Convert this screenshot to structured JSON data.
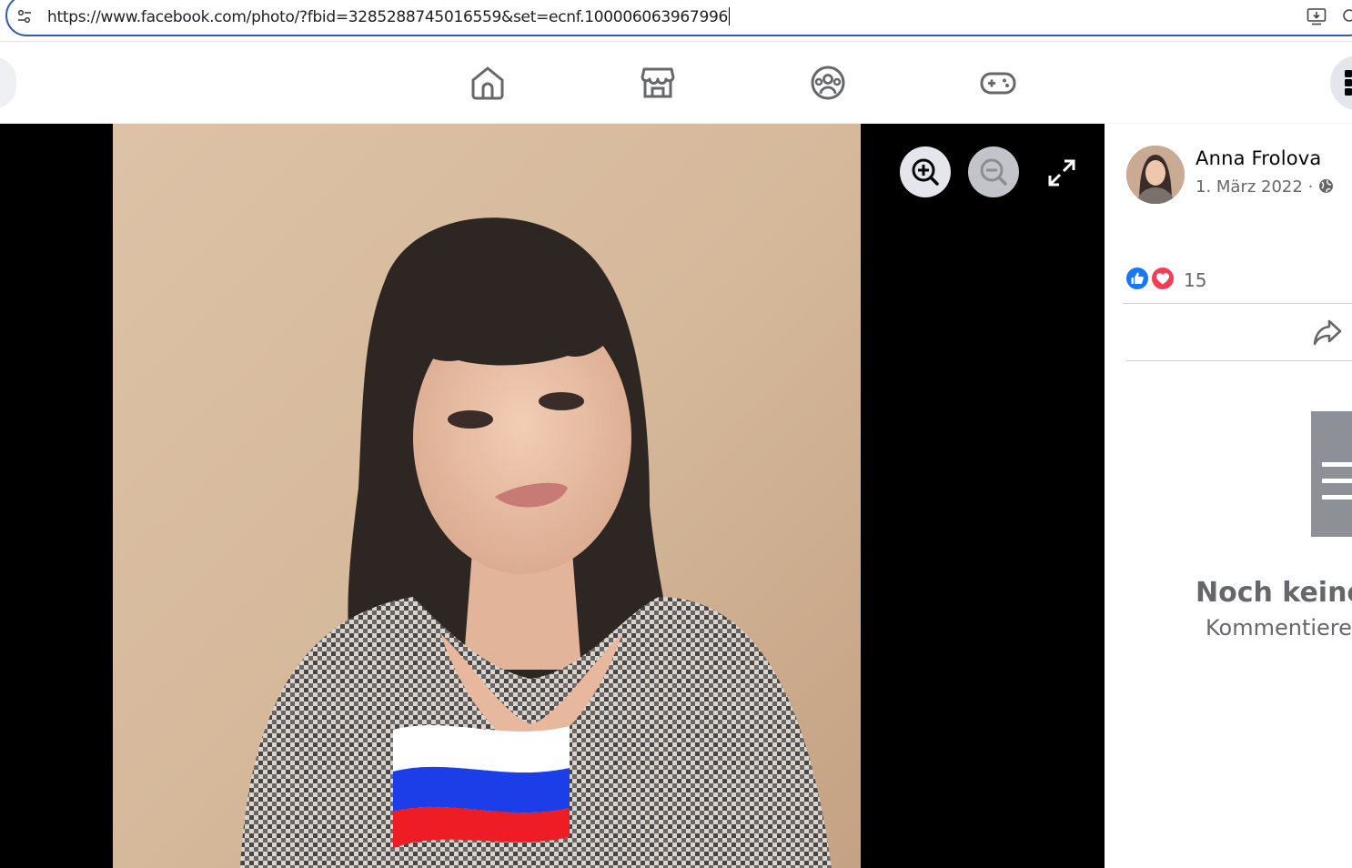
{
  "browser": {
    "url": "https://www.facebook.com/photo/?fbid=3285288745016559&set=ecnf.100006063967996",
    "icons": [
      "site-info-icon",
      "install-app-icon",
      "zoom-icon"
    ]
  },
  "nav": {
    "icons": [
      "home-icon",
      "marketplace-icon",
      "groups-icon",
      "gaming-icon",
      "menu-icon"
    ]
  },
  "viewer": {
    "photo_description_icon": "flag-russia",
    "controls": [
      "zoom-in-icon",
      "zoom-out-icon",
      "fullscreen-icon"
    ]
  },
  "post": {
    "author": "Anna Frolova",
    "date": "1. März 2022",
    "date_separator": "·",
    "audience_icon": "globe-icon",
    "reaction_icons": [
      "like-icon",
      "love-icon"
    ],
    "reaction_count": "15",
    "share_icon": "share-icon"
  },
  "comments": {
    "empty_title": "Noch keine",
    "empty_subtitle": "Kommentiere"
  },
  "colors": {
    "url_border": "#2f5fb5",
    "like_blue": "#1877f2",
    "love_red": "#f33e58",
    "secondary_text": "#65676b",
    "viewer_bg": "#000000",
    "flag_white": "#ffffff",
    "flag_blue": "#1c3ee8",
    "flag_red": "#ee1c25"
  }
}
